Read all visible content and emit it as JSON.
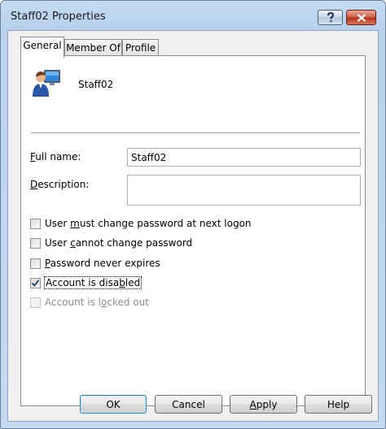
{
  "window": {
    "title": "Staff02 Properties",
    "title_buttons": {
      "help": "?",
      "close": "close"
    }
  },
  "tabs": [
    {
      "label": "General",
      "active": true
    },
    {
      "label": "Member Of",
      "active": false
    },
    {
      "label": "Profile",
      "active": false
    }
  ],
  "general": {
    "header_name": "Staff02",
    "full_name": {
      "label_pre": "",
      "label_mn": "F",
      "label_post": "ull name:",
      "value": "Staff02"
    },
    "description": {
      "label_pre": "",
      "label_mn": "D",
      "label_post": "escription:",
      "value": ""
    },
    "checkboxes": [
      {
        "pre": "User ",
        "mn": "m",
        "post": "ust change password at next logon",
        "checked": false,
        "disabled": false
      },
      {
        "pre": "User ",
        "mn": "c",
        "post": "annot change password",
        "checked": false,
        "disabled": false
      },
      {
        "pre": "",
        "mn": "P",
        "post": "assword never expires",
        "checked": false,
        "disabled": false
      },
      {
        "pre": "Account is disa",
        "mn": "b",
        "post": "led",
        "checked": true,
        "disabled": false
      },
      {
        "pre": "Account is l",
        "mn": "o",
        "post": "cked out",
        "checked": false,
        "disabled": true
      }
    ]
  },
  "buttons": {
    "ok": "OK",
    "cancel": "Cancel",
    "apply": {
      "pre": "",
      "mn": "A",
      "post": "pply"
    },
    "help": "Help"
  },
  "icons": {
    "user": "user-account-icon",
    "check": "check-icon"
  }
}
